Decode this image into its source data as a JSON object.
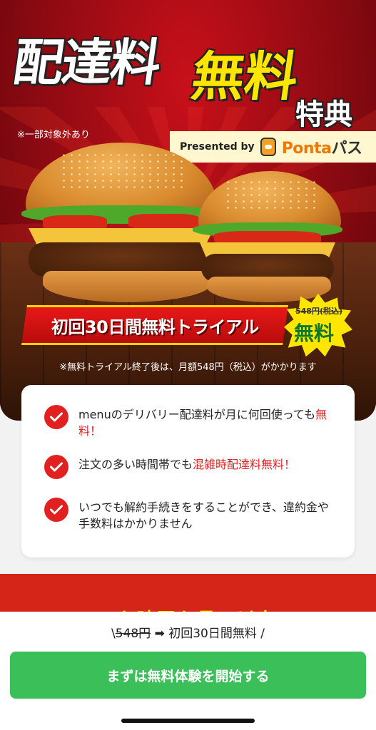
{
  "hero": {
    "title_main": "配達料",
    "title_free": "無料",
    "title_suffix": "特典",
    "exclude_note": "※一部対象外あり",
    "presented_by": "Presented by",
    "ponta_logo": "Ponta",
    "ponta_logo_suffix": "パス",
    "trial_banner": "初回30日間無料トライアル",
    "badge_price": "548円(税込)",
    "badge_free": "無料",
    "after_trial_note": "※無料トライアル終了後は、月額548円（税込）がかかります"
  },
  "benefits": [
    {
      "text": "menuのデリバリー配達料が月に何回使っても",
      "highlight": "無料！"
    },
    {
      "text": "注文の多い時間帯でも",
      "highlight": "混雑時配達料無料！"
    },
    {
      "text": "いつでも解約手続きをすることができ、違約金や手数料はかかりません",
      "highlight": ""
    }
  ],
  "next_section": {
    "peek_text": "menuも映画も月一以上"
  },
  "bottom": {
    "price_prefix": "\\",
    "price_old": "548円",
    "price_arrow": "➡",
    "price_new": "初回30日間無料 /",
    "cta_label": "まずは無料体験を開始する"
  },
  "colors": {
    "brand_red": "#e12020",
    "cta_green": "#3bbf59",
    "accent_yellow": "#ffe600"
  }
}
